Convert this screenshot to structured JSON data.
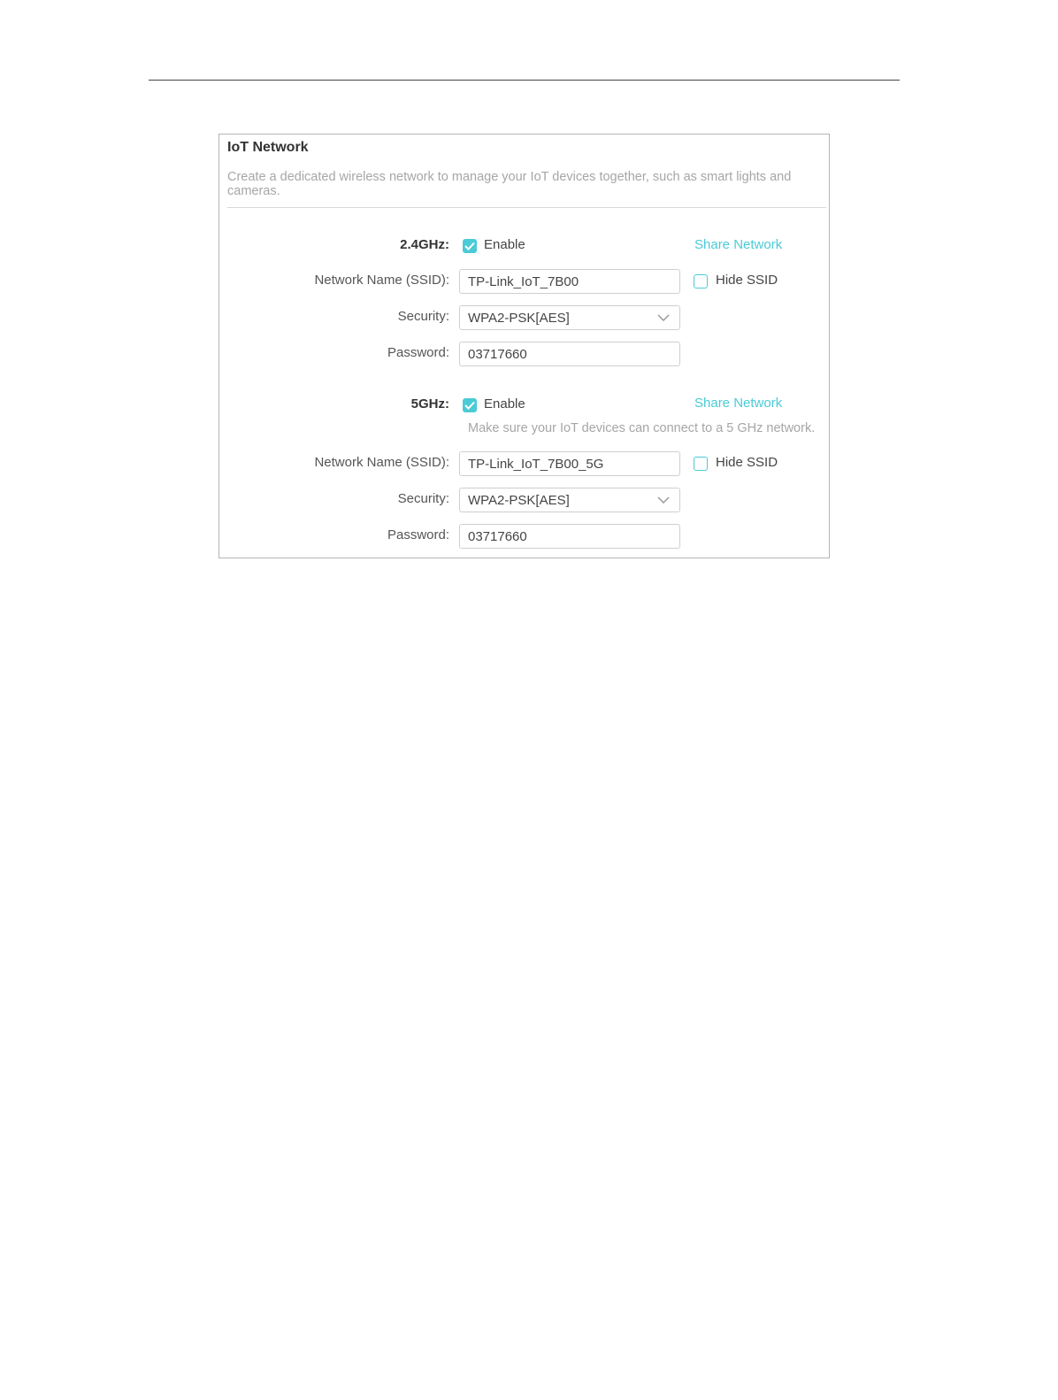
{
  "panel": {
    "title": "IoT Network",
    "description": "Create a dedicated wireless network to manage your IoT devices together, such as smart lights and cameras."
  },
  "band24": {
    "label": "2.4GHz:",
    "enable_label": "Enable",
    "enabled": true,
    "share_label": "Share Network",
    "ssid_label": "Network Name (SSID):",
    "ssid_value": "TP-Link_IoT_7B00",
    "hide_ssid_label": "Hide SSID",
    "hide_ssid": false,
    "security_label": "Security:",
    "security_value": "WPA2-PSK[AES]",
    "password_label": "Password:",
    "password_value": "03717660"
  },
  "band5": {
    "label": "5GHz:",
    "enable_label": "Enable",
    "enabled": true,
    "share_label": "Share Network",
    "hint": "Make sure your IoT devices can connect to a 5 GHz network.",
    "ssid_label": "Network Name (SSID):",
    "ssid_value": "TP-Link_IoT_7B00_5G",
    "hide_ssid_label": "Hide SSID",
    "hide_ssid": false,
    "security_label": "Security:",
    "security_value": "WPA2-PSK[AES]",
    "password_label": "Password:",
    "password_value": "03717660"
  },
  "colors": {
    "accent": "#4acbd6",
    "hint_text": "#a6a6a6",
    "border": "#b5b5b5"
  },
  "icons": {
    "checkbox_checked": "check-icon",
    "dropdown": "chevron-down-icon"
  }
}
